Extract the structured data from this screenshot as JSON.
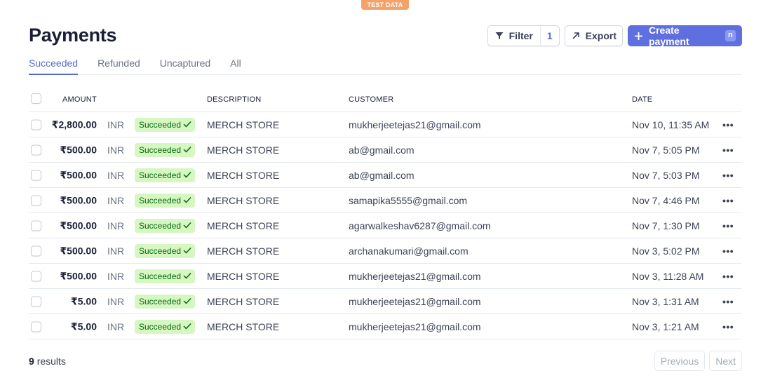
{
  "banner": {
    "label": "TEST DATA"
  },
  "page": {
    "title": "Payments"
  },
  "actions": {
    "filter_label": "Filter",
    "filter_count": "1",
    "export_label": "Export",
    "create_label": "Create payment",
    "create_shortcut": "n"
  },
  "tabs": [
    {
      "label": "Succeeded",
      "active": true
    },
    {
      "label": "Refunded",
      "active": false
    },
    {
      "label": "Uncaptured",
      "active": false
    },
    {
      "label": "All",
      "active": false
    }
  ],
  "table": {
    "headers": {
      "amount": "AMOUNT",
      "description": "DESCRIPTION",
      "customer": "CUSTOMER",
      "date": "DATE"
    },
    "rows": [
      {
        "amount": "₹2,800.00",
        "currency": "INR",
        "status": "Succeeded",
        "description": "MERCH STORE",
        "customer": "mukherjeetejas21@gmail.com",
        "date": "Nov 10, 11:35 AM"
      },
      {
        "amount": "₹500.00",
        "currency": "INR",
        "status": "Succeeded",
        "description": "MERCH STORE",
        "customer": "ab@gmail.com",
        "date": "Nov 7, 5:05 PM"
      },
      {
        "amount": "₹500.00",
        "currency": "INR",
        "status": "Succeeded",
        "description": "MERCH STORE",
        "customer": "ab@gmail.com",
        "date": "Nov 7, 5:03 PM"
      },
      {
        "amount": "₹500.00",
        "currency": "INR",
        "status": "Succeeded",
        "description": "MERCH STORE",
        "customer": "samapika5555@gmail.com",
        "date": "Nov 7, 4:46 PM"
      },
      {
        "amount": "₹500.00",
        "currency": "INR",
        "status": "Succeeded",
        "description": "MERCH STORE",
        "customer": "agarwalkeshav6287@gmail.com",
        "date": "Nov 7, 1:30 PM"
      },
      {
        "amount": "₹500.00",
        "currency": "INR",
        "status": "Succeeded",
        "description": "MERCH STORE",
        "customer": "archanakumari@gmail.com",
        "date": "Nov 3, 5:02 PM"
      },
      {
        "amount": "₹500.00",
        "currency": "INR",
        "status": "Succeeded",
        "description": "MERCH STORE",
        "customer": "mukherjeetejas21@gmail.com",
        "date": "Nov 3, 11:28 AM"
      },
      {
        "amount": "₹5.00",
        "currency": "INR",
        "status": "Succeeded",
        "description": "MERCH STORE",
        "customer": "mukherjeetejas21@gmail.com",
        "date": "Nov 3, 1:31 AM"
      },
      {
        "amount": "₹5.00",
        "currency": "INR",
        "status": "Succeeded",
        "description": "MERCH STORE",
        "customer": "mukherjeetejas21@gmail.com",
        "date": "Nov 3, 1:21 AM"
      }
    ]
  },
  "footer": {
    "results_count": "9",
    "results_label": "results",
    "previous_label": "Previous",
    "next_label": "Next"
  },
  "colors": {
    "accent": "#5469d4",
    "success_bg": "#d7f7c2",
    "success_text": "#05690d",
    "test_badge": "#f5a26a"
  },
  "icons": {
    "filter": "filter-icon",
    "export": "arrow-up-right-icon",
    "create": "plus-icon",
    "status": "checkmark-icon",
    "row_menu": "more-icon"
  }
}
